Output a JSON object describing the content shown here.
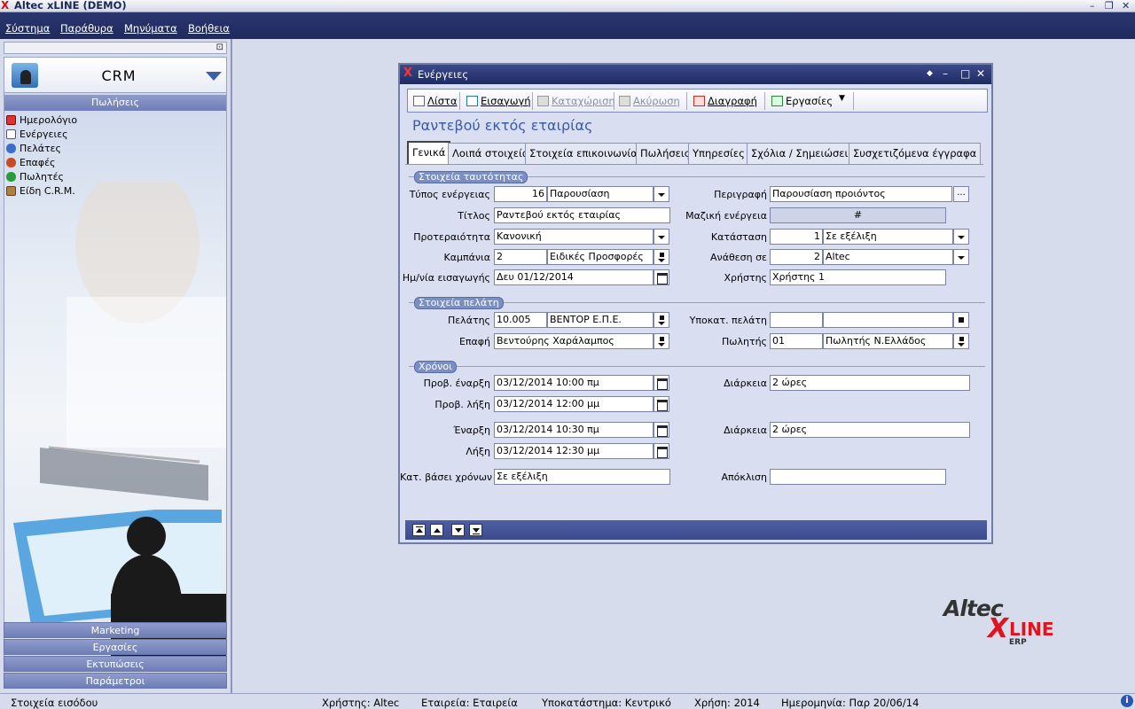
{
  "app": {
    "title": "Altec xLINE (DEMO)"
  },
  "menubar": {
    "items": [
      "Σύστημα",
      "Παράθυρα",
      "Μηνύματα",
      "Βοήθεια"
    ]
  },
  "sidebar": {
    "module": "CRM",
    "section": "Πωλήσεις",
    "items": [
      "Ημερολόγιο",
      "Ενέργειες",
      "Πελάτες",
      "Επαφές",
      "Πωλητές",
      "Είδη C.R.M."
    ],
    "sections": [
      "Marketing",
      "Εργασίες",
      "Εκτυπώσεις",
      "Παράμετροι"
    ]
  },
  "window": {
    "title": "Ενέργειες",
    "form_title": "Ραντεβού εκτός εταιρίας",
    "toolbar": {
      "list": "Λίστα",
      "insert": "Εισαγωγή",
      "save": "Καταχώριση",
      "cancel": "Ακύρωση",
      "delete": "Διαγραφή",
      "tasks": "Εργασίες"
    },
    "tabs": [
      "Γενικά",
      "Λοιπά στοιχεία",
      "Στοιχεία επικοινωνίας",
      "Πωλήσεις",
      "Υπηρεσίες",
      "Σχόλια / Σημειώσεις",
      "Συσχετιζόμενα έγγραφα"
    ],
    "identity": {
      "title": "Στοιχεία ταυτότητας",
      "type_label": "Τύπος ενέργειας",
      "type_code": "16",
      "type_name": "Παρουσίαση",
      "desc_label": "Περιγραφή",
      "desc_value": "Παρουσίαση προιόντος",
      "title_label": "Τίτλος",
      "title_value": "Ραντεβού εκτός εταιρίας",
      "mass_label": "Μαζική ενέργεια",
      "mass_value": "#",
      "priority_label": "Προτεραιότητα",
      "priority_value": "Κανονική",
      "status_label": "Κατάσταση",
      "status_code": "1",
      "status_name": "Σε εξέλιξη",
      "campaign_label": "Καμπάνια",
      "campaign_code": "2",
      "campaign_name": "Ειδικές Προσφορές",
      "assign_label": "Ανάθεση σε",
      "assign_code": "2",
      "assign_name": "Altec",
      "date_label": "Ημ/νία εισαγωγής",
      "date_value": "Δευ 01/12/2014",
      "user_label": "Χρήστης",
      "user_value": "Χρήστης 1"
    },
    "customer": {
      "title": "Στοιχεία πελάτη",
      "customer_label": "Πελάτης",
      "customer_code": "10.005",
      "customer_name": "ΒΕΝΤΟΡ Ε.Π.Ε.",
      "branch_label": "Υποκατ. πελάτη",
      "branch_code": "",
      "branch_name": "",
      "contact_label": "Επαφή",
      "contact_value": "Βεντούρης Χαράλαμπος",
      "salesman_label": "Πωλητής",
      "salesman_code": "01",
      "salesman_name": "Πωλητής Ν.Ελλάδος"
    },
    "times": {
      "title": "Χρόνοι",
      "plan_start_label": "Προβ. έναρξη",
      "plan_start": "03/12/2014 10:00 πμ",
      "plan_end_label": "Προβ. λήξη",
      "plan_end": "03/12/2014 12:00 μμ",
      "plan_dur_label": "Διάρκεια",
      "plan_dur": "2 ώρες",
      "start_label": "Έναρξη",
      "start": "03/12/2014 10:30 πμ",
      "end_label": "Λήξη",
      "end": "03/12/2014 12:30 μμ",
      "dur_label": "Διάρκεια",
      "dur": "2 ώρες",
      "state_label": "Κατ. βάσει χρόνων",
      "state": "Σε εξέλιξη",
      "deviation_label": "Απόκλιση",
      "deviation": ""
    }
  },
  "logo": {
    "brand": "Altec",
    "x": "X",
    "line": "LINE",
    "erp": "ERP"
  },
  "statusbar": {
    "left": "Στοιχεία εισόδου",
    "user": "Χρήστης: Altec",
    "company": "Εταιρεία: Εταιρεία",
    "branch": "Υποκατάστημα: Κεντρικό",
    "year": "Χρήση: 2014",
    "date": "Ημερομηνία: Παρ 20/06/14"
  }
}
